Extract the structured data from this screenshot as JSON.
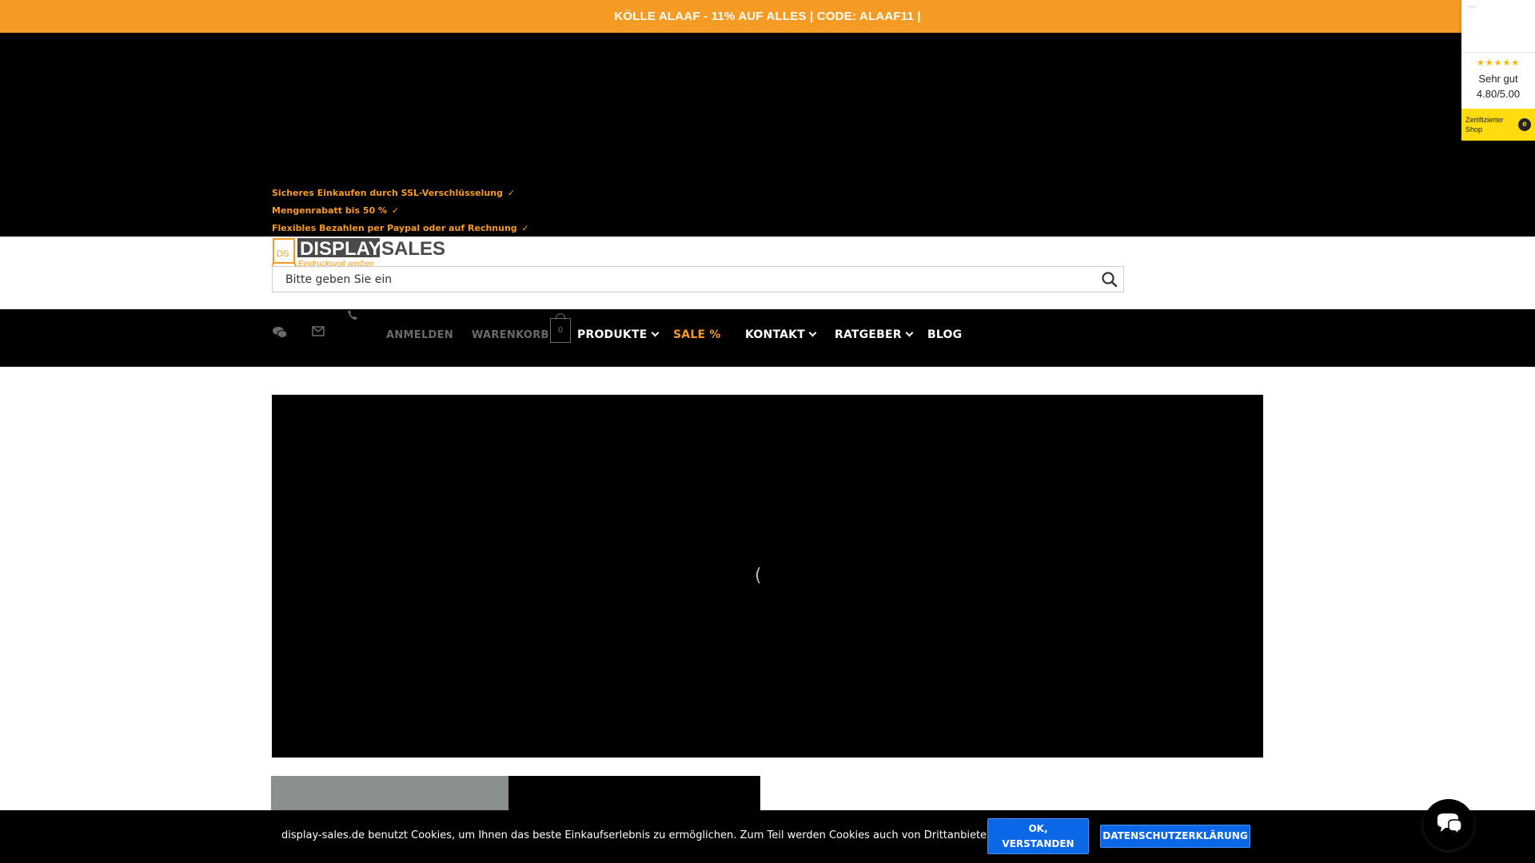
{
  "promo": {
    "text": "KÖLLE ALAAF - 11% AUF ALLES | CODE: ALAAF11 |"
  },
  "usps": [
    {
      "text": "Sicheres Einkaufen durch SSL-Verschlüsselung",
      "check": "✓"
    },
    {
      "text": "Mengenrabatt bis 50 %",
      "check": "✓"
    },
    {
      "text": "Flexibles Bezahlen per Paypal oder auf Rechnung",
      "check": "✓"
    }
  ],
  "logo": {
    "brand_left": "DISPLAY",
    "brand_right": "SALES",
    "tagline": "Eindrucksvoll werben",
    "mark": "DS"
  },
  "search": {
    "placeholder": "Bitte geben Sie ein",
    "icon": "search-icon"
  },
  "nav": {
    "icons": [
      "chat-icon",
      "mail-icon",
      "phone-icon"
    ],
    "login": "ANMELDEN",
    "cart": "WARENKORB",
    "cart_count": "0",
    "items": [
      {
        "label": "PRODUKTE",
        "has_dropdown": true
      },
      {
        "label": "SALE %",
        "has_dropdown": false
      },
      {
        "label": "KONTAKT",
        "has_dropdown": true
      },
      {
        "label": "RATGEBER",
        "has_dropdown": true
      },
      {
        "label": "BLOG",
        "has_dropdown": false
      }
    ]
  },
  "hero": {
    "spinner_glyph": "("
  },
  "trust_badge": {
    "dots": "...",
    "stars": "★★★★★",
    "rating_label": "Sehr gut",
    "score": "4.80/5.00",
    "cert_label": "Zertifizierter Shop",
    "cert_logo": "e"
  },
  "cookie": {
    "text": "display-sales.de benutzt Cookies, um Ihnen das beste Einkaufserlebnis zu ermöglichen. Zum Teil werden Cookies auch von Drittanbietern gesetzt.",
    "ok_label_1": "OK,",
    "ok_label_2": "VERSTANDEN",
    "privacy_label": "DATENSCHUTZERKLÄRUNG"
  },
  "colors": {
    "accent": "#f59b23",
    "nav_bg": "#000000",
    "button_blue": "#0a67e6",
    "trust_yellow": "#ffdc0f"
  }
}
